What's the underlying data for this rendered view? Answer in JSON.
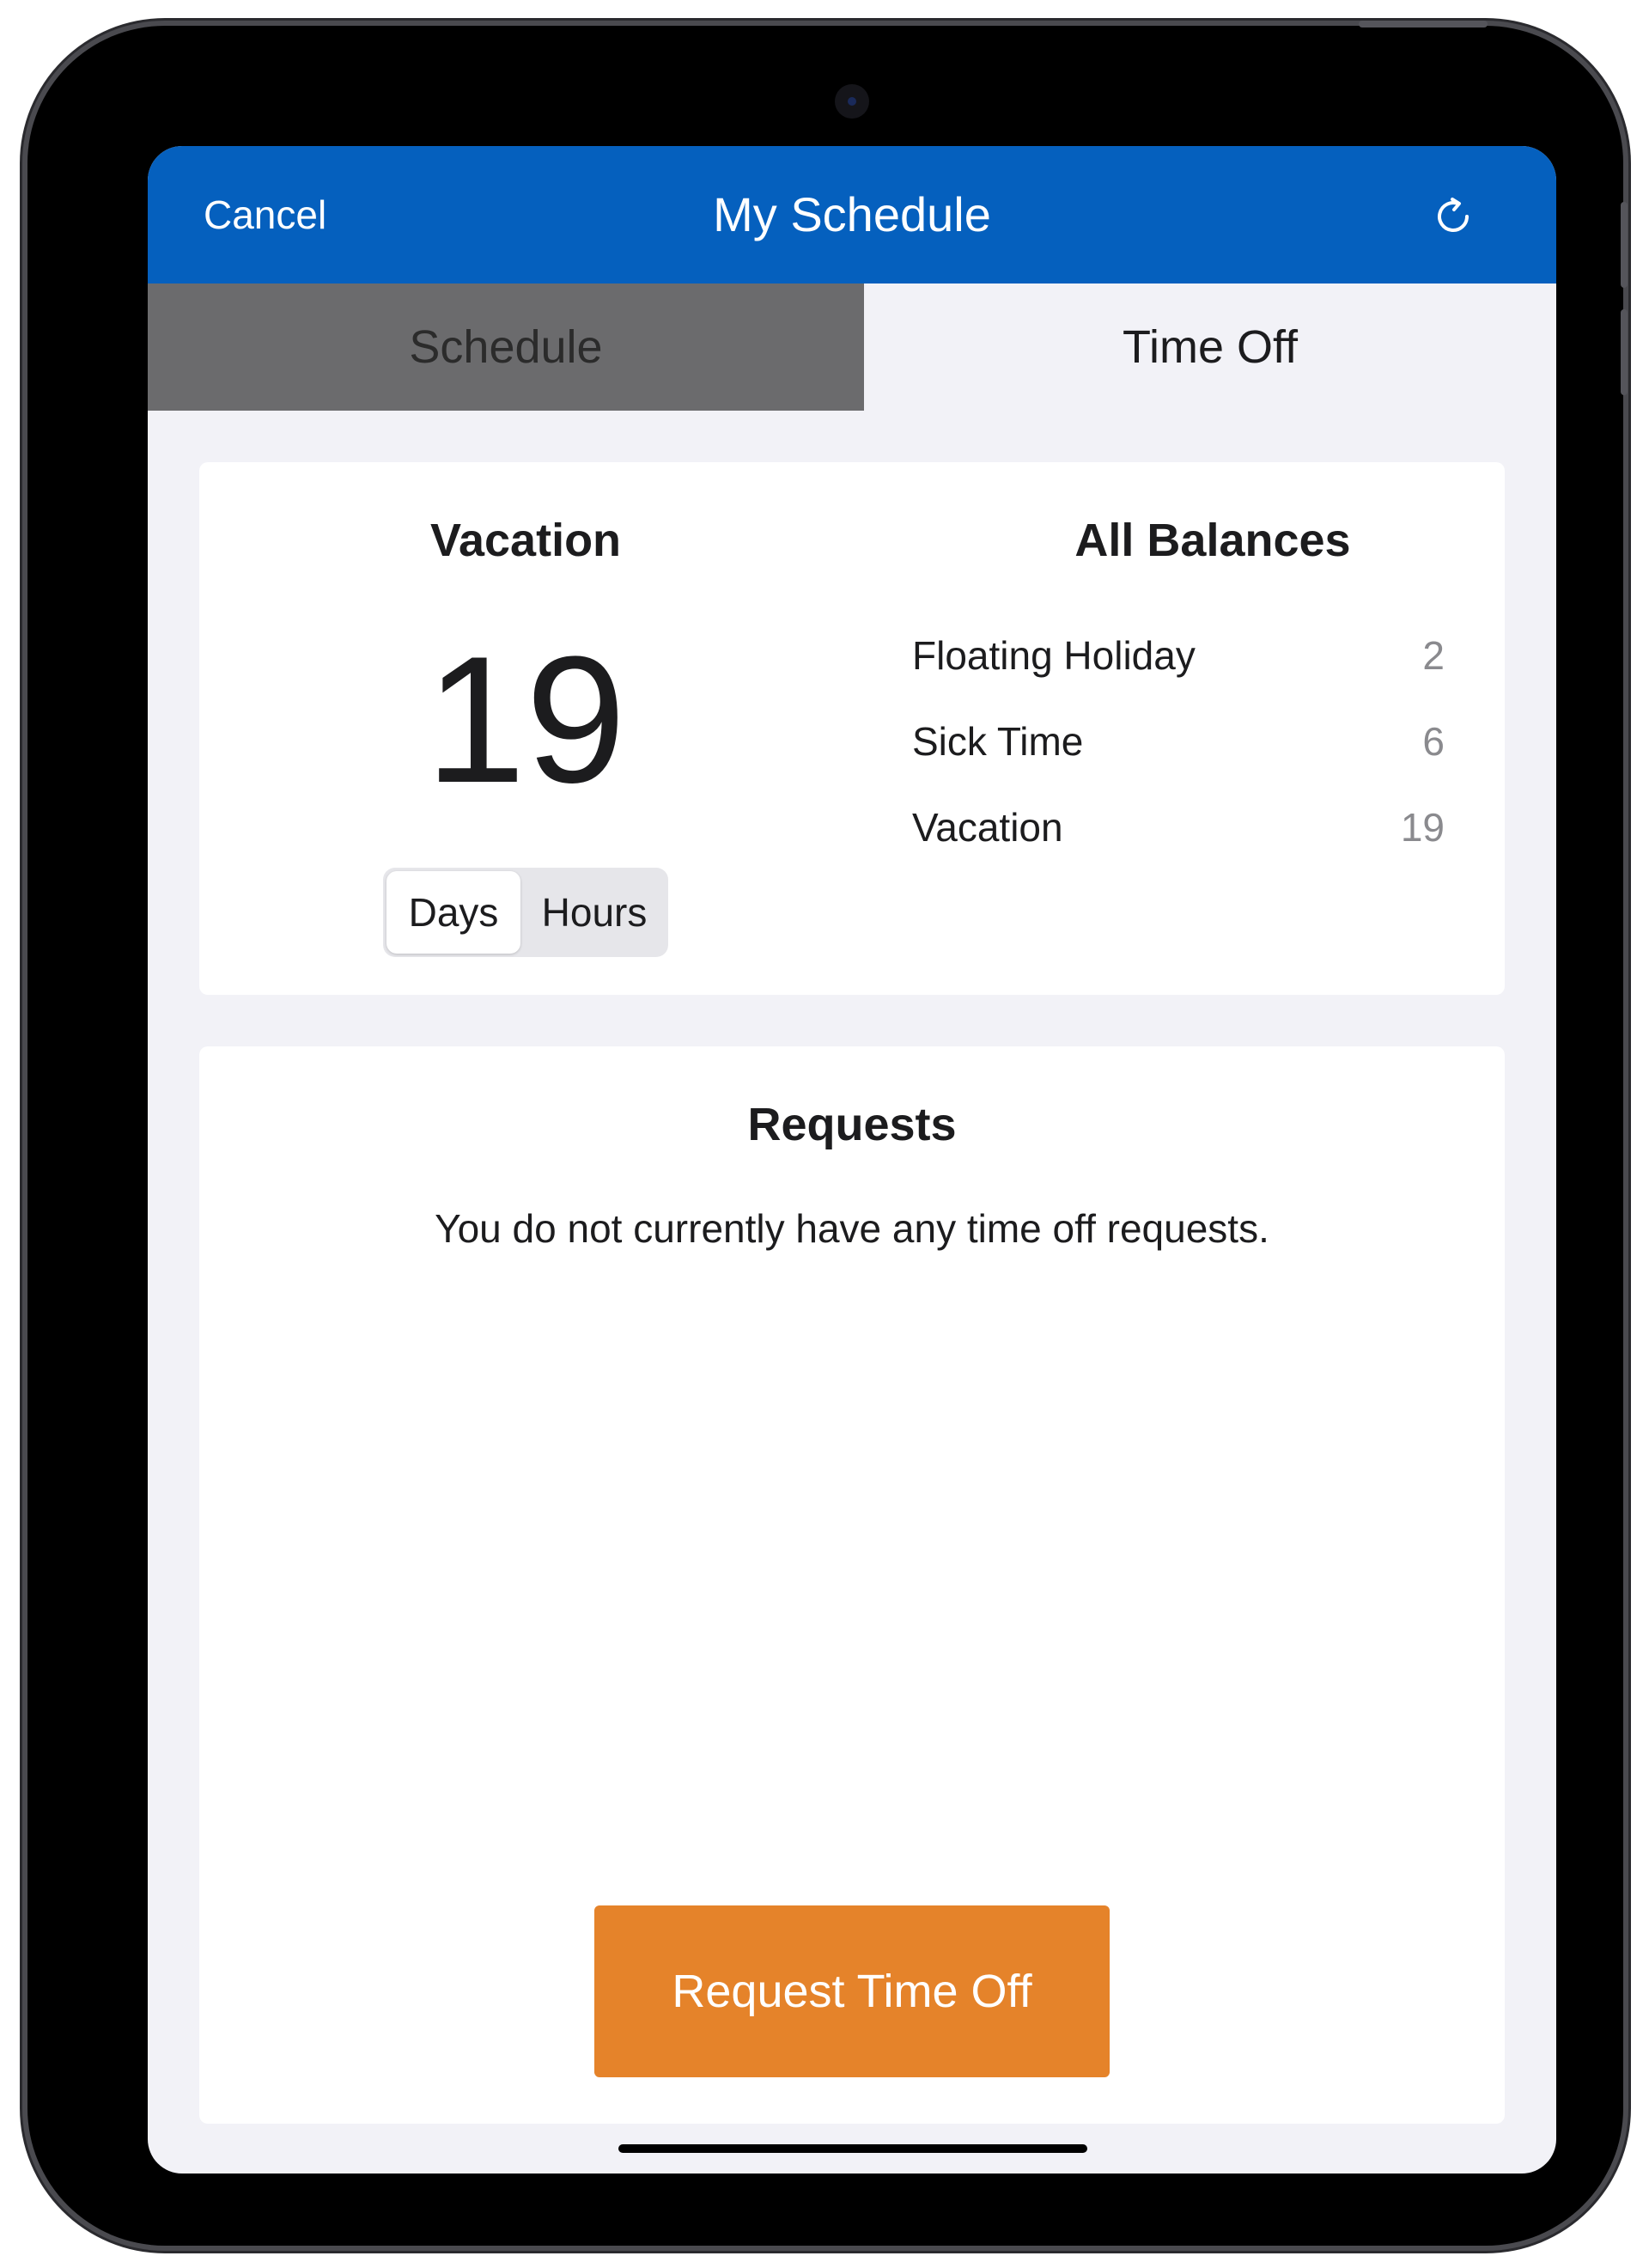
{
  "navbar": {
    "cancel_label": "Cancel",
    "title": "My Schedule",
    "refresh_icon": "refresh-icon",
    "color": "#0560be"
  },
  "tabs": [
    {
      "label": "Schedule",
      "selected": false
    },
    {
      "label": "Time Off",
      "selected": true
    }
  ],
  "vacation_panel": {
    "title": "Vacation",
    "value": "19",
    "unit_toggle": {
      "options": [
        "Days",
        "Hours"
      ],
      "selected": "Days"
    }
  },
  "balances": {
    "title": "All Balances",
    "items": [
      {
        "name": "Floating Holiday",
        "value": "2"
      },
      {
        "name": "Sick Time",
        "value": "6"
      },
      {
        "name": "Vacation",
        "value": "19"
      }
    ]
  },
  "requests": {
    "title": "Requests",
    "empty_message": "You do not currently have any time off requests.",
    "button_label": "Request Time Off",
    "button_color": "#e5832a"
  }
}
